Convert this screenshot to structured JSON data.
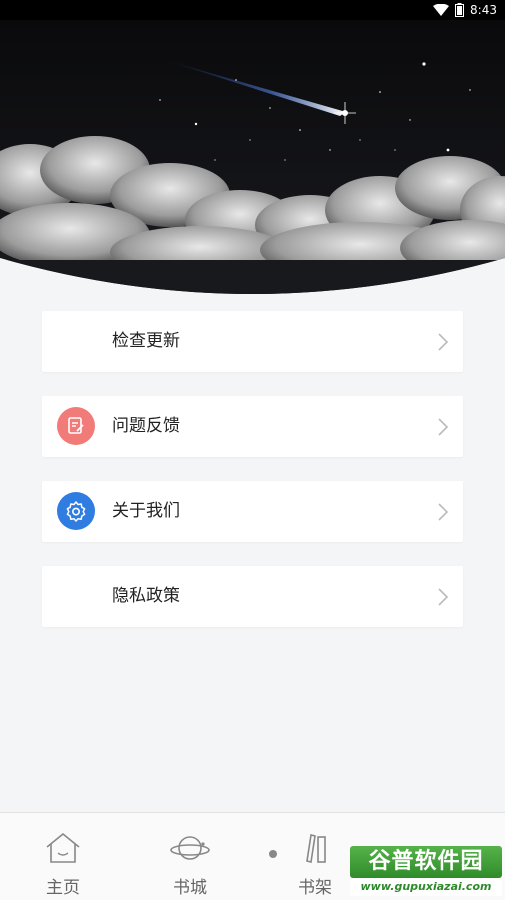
{
  "status_bar": {
    "time": "8:43"
  },
  "menu": [
    {
      "label": "检查更新",
      "icon": "none"
    },
    {
      "label": "问题反馈",
      "icon": "feedback-icon",
      "color": "#f07b78"
    },
    {
      "label": "关于我们",
      "icon": "gear-icon",
      "color": "#2f7de1"
    },
    {
      "label": "隐私政策",
      "icon": "none"
    }
  ],
  "bottom_nav": [
    {
      "label": "主页",
      "icon": "home-icon"
    },
    {
      "label": "书城",
      "icon": "planet-icon"
    },
    {
      "label": "书架",
      "icon": "bookshelf-icon"
    }
  ],
  "watermark": {
    "title": "谷普软件园",
    "url": "www.gupuxiazai.com"
  }
}
